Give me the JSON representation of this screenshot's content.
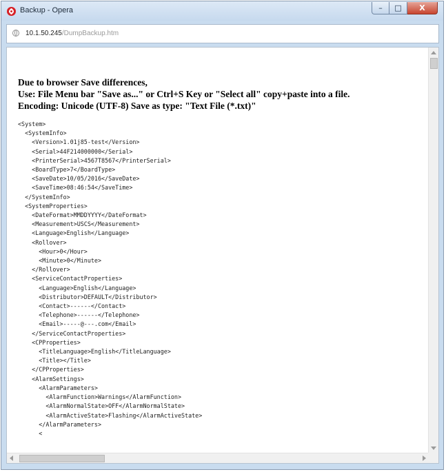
{
  "window": {
    "title": "Backup - Opera",
    "buttons": {
      "minimize": "–",
      "maximize": "□",
      "close": "X"
    }
  },
  "address": {
    "host": "10.1.50.245",
    "path": "/DumpBackup.htm"
  },
  "notice": {
    "line1": "Due to browser Save differences,",
    "line2": "Use: File Menu bar \"Save as...\" or Ctrl+S Key or \"Select all\" copy+paste into a file.",
    "line3": "Encoding: Unicode (UTF-8) Save as type: \"Text File (*.txt)\""
  },
  "xml_lines": [
    "<System>",
    "  <SystemInfo>",
    "    <Version>1.01j85-test</Version>",
    "    <Serial>44F214000000</Serial>",
    "    <PrinterSerial>4567T8567</PrinterSerial>",
    "    <BoardType>7</BoardType>",
    "    <SaveDate>10/05/2016</SaveDate>",
    "    <SaveTime>08:46:54</SaveTime>",
    "  </SystemInfo>",
    "  <SystemProperties>",
    "    <DateFormat>MMDDYYYY</DateFormat>",
    "    <Measurement>USCS</Measurement>",
    "    <Language>English</Language>",
    "    <Rollover>",
    "      <Hour>0</Hour>",
    "      <Minute>0</Minute>",
    "    </Rollover>",
    "    <ServiceContactProperties>",
    "      <Language>English</Language>",
    "      <Distributor>DEFAULT</Distributor>",
    "      <Contact>------</Contact>",
    "      <Telephone>------</Telephone>",
    "      <Email>-----@---.com</Email>",
    "    </ServiceContactProperties>",
    "    <CPProperties>",
    "      <TitleLanguage>English</TitleLanguage>",
    "      <Title></Title>",
    "    </CPProperties>",
    "    <AlarmSettings>",
    "      <AlarmParameters>",
    "        <AlarmFunction>Warnings</AlarmFunction>",
    "        <AlarmNormalState>OFF</AlarmNormalState>",
    "        <AlarmActiveState>Flashing</AlarmActiveState>",
    "      </AlarmParameters>",
    "      <"
  ]
}
